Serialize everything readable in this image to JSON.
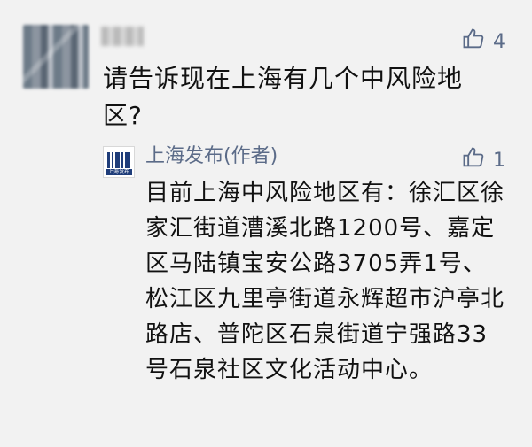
{
  "comment": {
    "likes": "4",
    "text": "请告诉现在上海有几个中风险地区?"
  },
  "reply": {
    "author": "上海发布(作者)",
    "logo_text": "上海发布",
    "likes": "1",
    "text": "目前上海中风险地区有：徐汇区徐家汇街道漕溪北路1200号、嘉定区马陆镇宝安公路3705弄1号、松江区九里亭街道永辉超市沪亭北路店、普陀区石泉街道宁强路33号石泉社区文化活动中心。"
  },
  "icons": {
    "avatar": "blurred-user-avatar",
    "thumb": "thumb-up-icon"
  },
  "colors": {
    "background": "#f2f2f2",
    "author_blue": "#5b6b88",
    "logo_blue": "#1f3d7a"
  }
}
